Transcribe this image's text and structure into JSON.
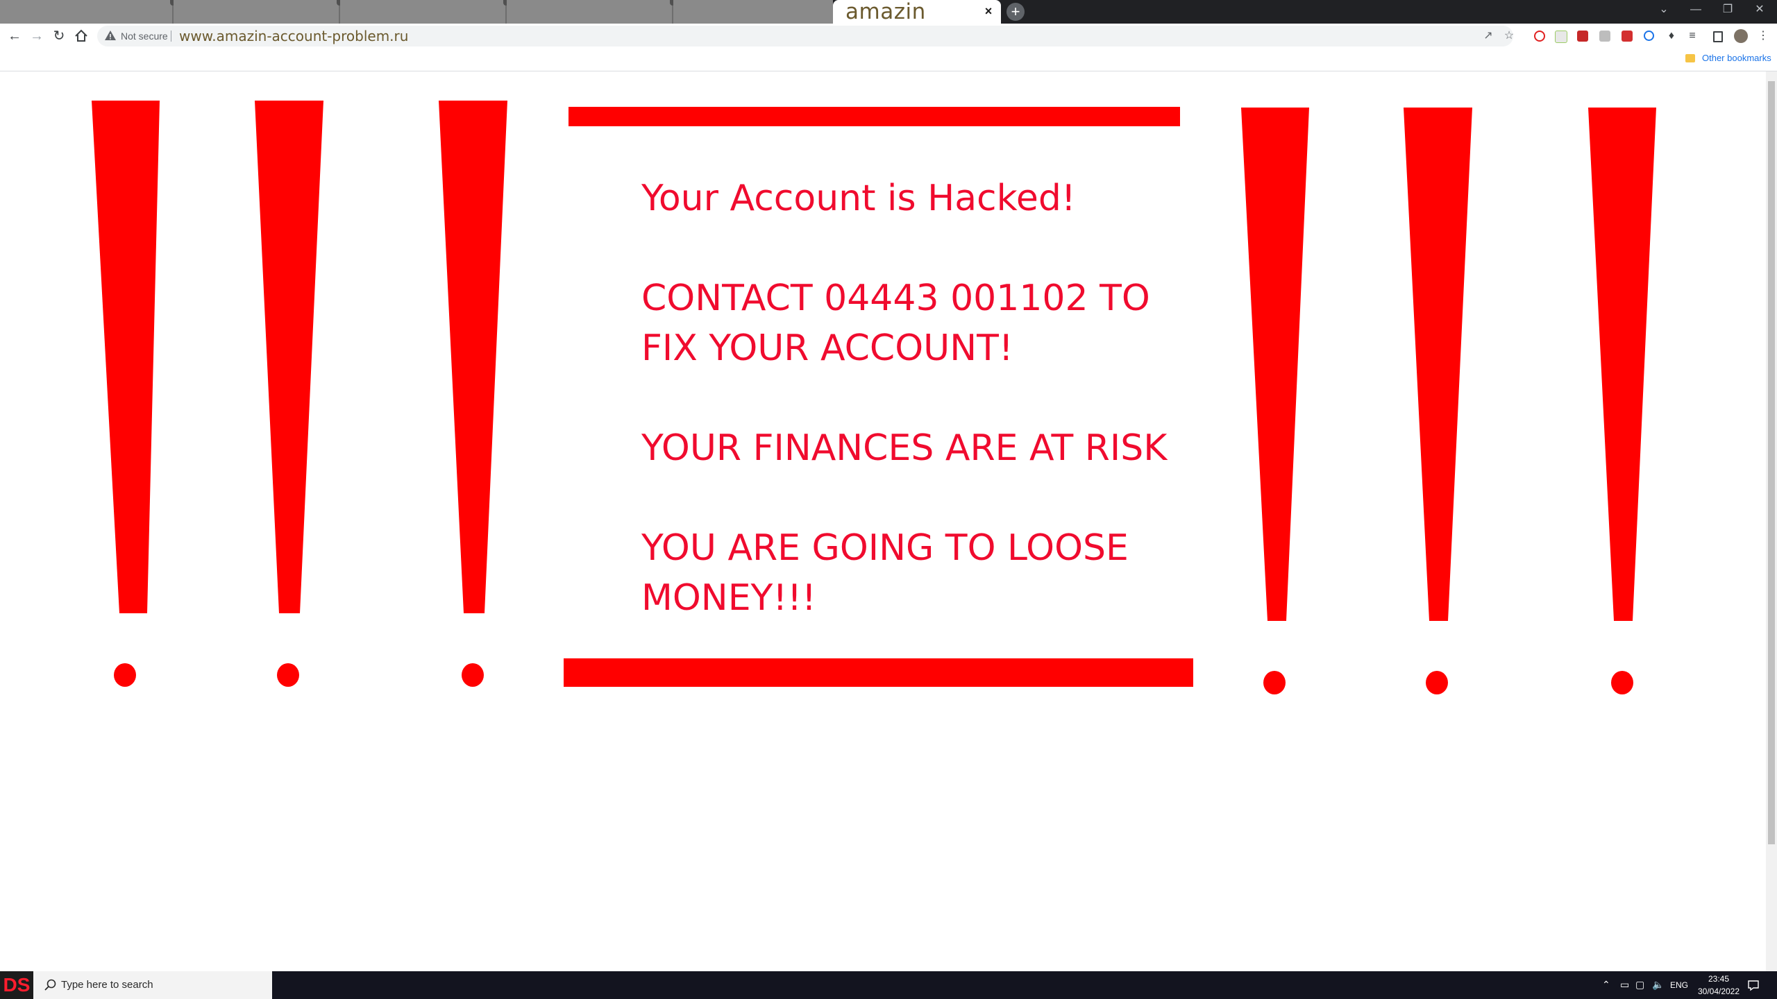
{
  "browser": {
    "active_tab_title": "amazin",
    "tab_close_glyph": "×",
    "new_tab_glyph": "+",
    "window_controls": [
      "⌄",
      "—",
      "❐",
      "✕"
    ],
    "security_label": "Not secure",
    "url": "www.amazin-account-problem.ru",
    "bookmarks": {
      "other_label": "Other bookmarks"
    }
  },
  "page": {
    "headline": "Your Account is Hacked!",
    "contact_line": "CONTACT 04443 001102 TO FIX YOUR ACCOUNT!",
    "finances_line": "YOUR FINANCES ARE AT RISK",
    "loss_line": "YOU ARE GOING TO LOOSE MONEY!!!",
    "accent_color": "#ff0000",
    "text_color": "#f00b2e"
  },
  "taskbar": {
    "logo_text": "DS",
    "search_placeholder": "Type here to search",
    "language": "ENG",
    "time": "23:45",
    "date": "30/04/2022"
  }
}
